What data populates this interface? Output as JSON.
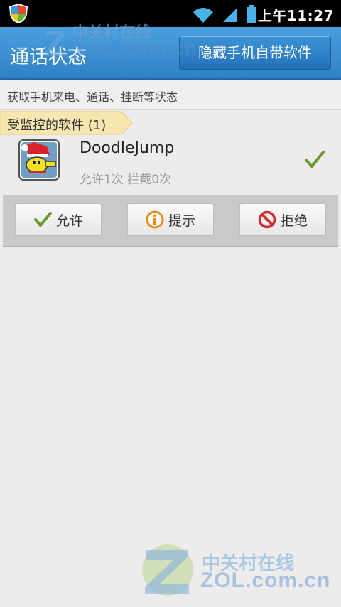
{
  "status_bar": {
    "time": "上午11:27",
    "icons": [
      "shield-icon",
      "wifi-icon",
      "signal-icon",
      "battery-icon"
    ]
  },
  "watermark": {
    "chinese": "中关村在线",
    "url": "ZOL.com.cn"
  },
  "header": {
    "title": "通话状态",
    "hide_button_label": "隐藏手机自带软件"
  },
  "subtitle": "获取手机来电、通话、挂断等状态",
  "group": {
    "label": "受监控的软件 (1)"
  },
  "apps": [
    {
      "name": "DoodleJump",
      "stats": "允许1次  拦截0次",
      "icon": "doodle-jump-icon",
      "status_icon": "check-icon"
    }
  ],
  "actions": {
    "allow": "允许",
    "prompt": "提示",
    "deny": "拒绝"
  },
  "colors": {
    "header_blue": "#3a8fd2",
    "check_green": "#6b9a2a",
    "tag_yellow": "#f6e7b0",
    "info_orange": "#e88a16",
    "deny_red": "#d22c2c"
  }
}
